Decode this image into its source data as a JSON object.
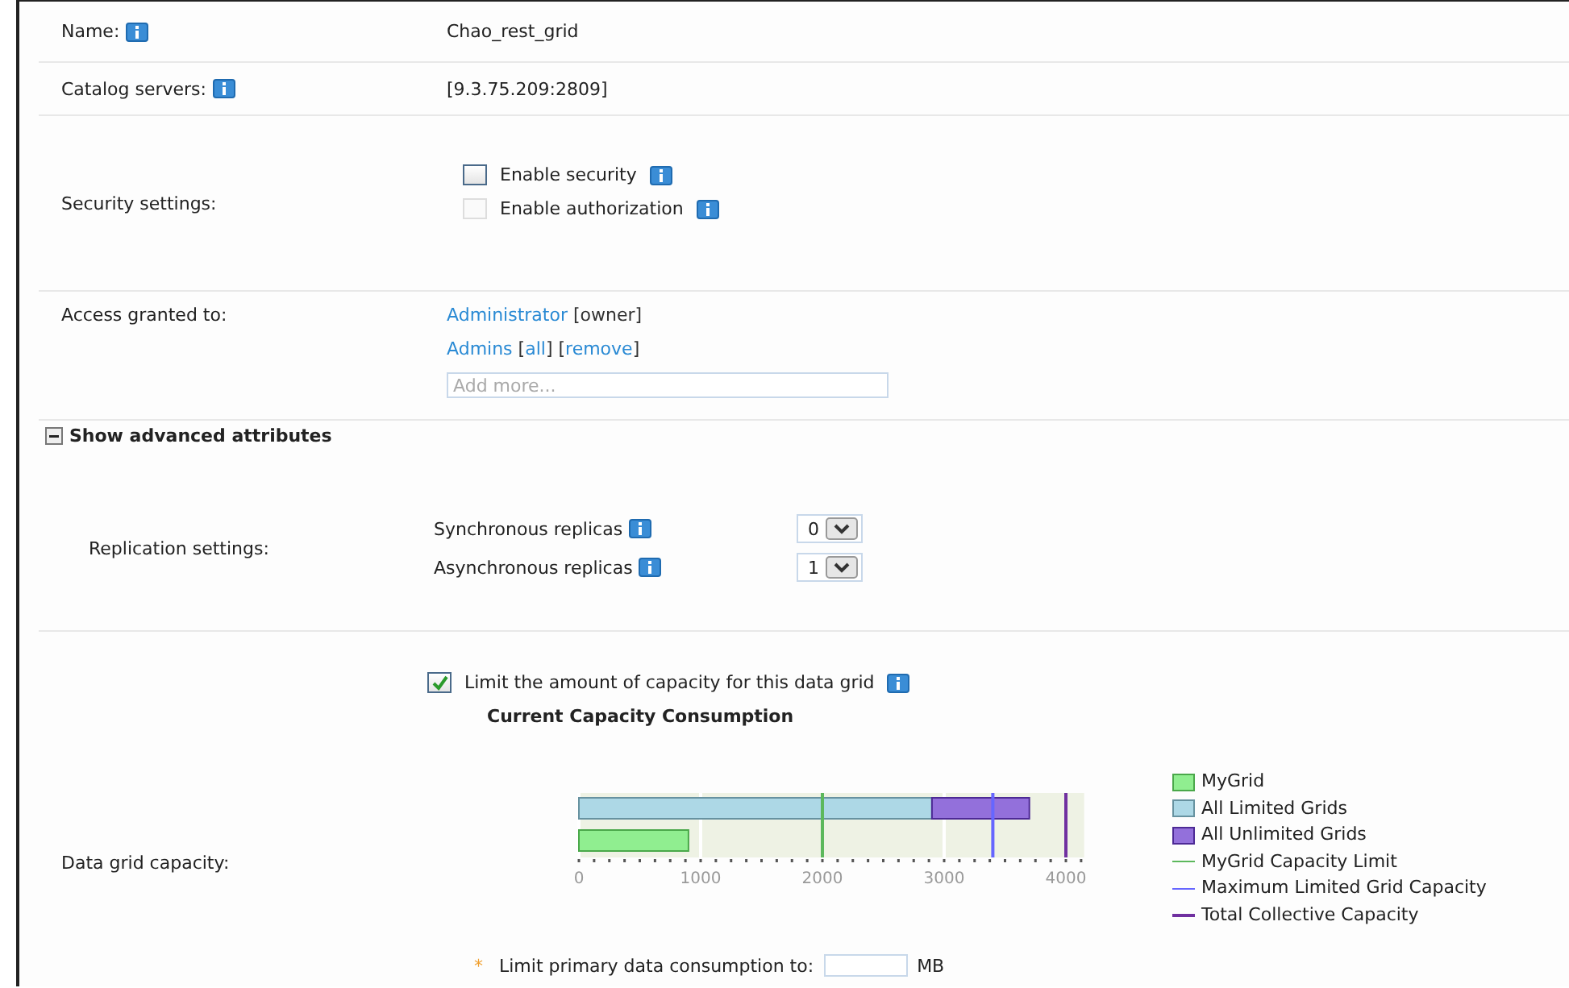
{
  "name": {
    "label": "Name:",
    "value": "Chao_rest_grid"
  },
  "catalog": {
    "label": "Catalog servers:",
    "value": "[9.3.75.209:2809]"
  },
  "security": {
    "label": "Security settings:",
    "options": [
      {
        "label": "Enable security",
        "checked": false,
        "disabled": false
      },
      {
        "label": "Enable authorization",
        "checked": false,
        "disabled": true
      }
    ]
  },
  "access": {
    "label": "Access granted to:",
    "entries": [
      {
        "parts": [
          {
            "kind": "link",
            "text": "Administrator"
          },
          {
            "kind": "plain",
            "text": " [owner]"
          }
        ]
      },
      {
        "parts": [
          {
            "kind": "link",
            "text": "Admins"
          },
          {
            "kind": "plain",
            "text": " ["
          },
          {
            "kind": "link",
            "text": "all"
          },
          {
            "kind": "plain",
            "text": "] ["
          },
          {
            "kind": "link",
            "text": "remove"
          },
          {
            "kind": "plain",
            "text": "]"
          }
        ]
      }
    ],
    "placeholder": "Add more..."
  },
  "advanced": {
    "label": "Show advanced attributes",
    "expanded": true
  },
  "replication": {
    "label": "Replication settings:",
    "items": [
      {
        "label": "Synchronous replicas",
        "value": "0"
      },
      {
        "label": "Asynchronous replicas",
        "value": "1"
      }
    ]
  },
  "capacity": {
    "label": "Data grid capacity:",
    "limit": {
      "label": "Limit the amount of capacity for this data grid",
      "checked": true
    },
    "chart_data": {
      "type": "bar",
      "orientation": "horizontal",
      "stacked": true,
      "title": "Current Capacity Consumption",
      "categories": [
        null,
        null
      ],
      "xlim": [
        0,
        4150
      ],
      "xticks": [
        0,
        1000,
        2000,
        3000,
        4000
      ],
      "series": [
        {
          "name": "MyGrid",
          "color": "#90ee90",
          "values": [
            null,
            900
          ]
        },
        {
          "name": "All Limited Grids",
          "color": "#add8e6",
          "values": [
            2900,
            null
          ]
        },
        {
          "name": "All Unlimited Grids",
          "color": "#9370db",
          "values": [
            800,
            null
          ]
        }
      ],
      "ref_lines": [
        {
          "axis": "x",
          "label": "MyGrid Capacity Limit",
          "value": 2000,
          "color": "#5cb85c"
        },
        {
          "axis": "x",
          "label": "Maximum Limited Grid Capacity",
          "value": 3400,
          "color": "#6666ff"
        },
        {
          "axis": "x",
          "label": "Total Collective Capacity",
          "value": 4000,
          "color": "#7030a0"
        }
      ]
    },
    "primary": {
      "required_mark": "*",
      "label": "Limit primary data consumption to:",
      "unit": "MB"
    }
  }
}
